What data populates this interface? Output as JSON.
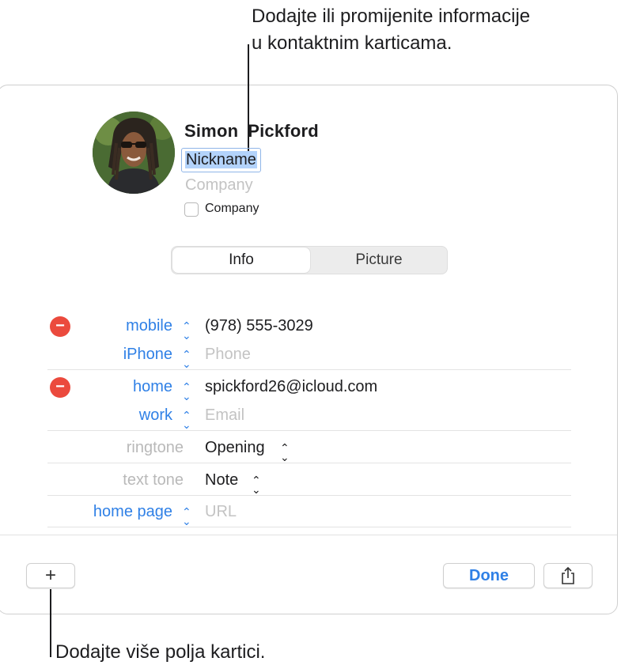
{
  "callouts": {
    "top_line1": "Dodajte ili promijenite informacije",
    "top_line2": "u kontaktnim karticama.",
    "bottom": "Dodajte više polja kartici."
  },
  "contact": {
    "first_name": "Simon",
    "last_name": "Pickford",
    "nickname": "Nickname",
    "company_placeholder": "Company",
    "company_checkbox_label": "Company",
    "company_checkbox_checked": false
  },
  "tabs": [
    {
      "label": "Info",
      "selected": true
    },
    {
      "label": "Picture",
      "selected": false
    }
  ],
  "fields": {
    "phone1": {
      "label": "mobile",
      "value": "(978) 555-3029"
    },
    "phone2": {
      "label": "iPhone",
      "placeholder": "Phone"
    },
    "email1": {
      "label": "home",
      "value": "spickford26@icloud.com"
    },
    "email2": {
      "label": "work",
      "placeholder": "Email"
    },
    "ringtone": {
      "label": "ringtone",
      "value": "Opening"
    },
    "texttone": {
      "label": "text tone",
      "value": "Note"
    },
    "homepage": {
      "label": "home page",
      "placeholder": "URL"
    }
  },
  "footer": {
    "add_label": "+",
    "done_label": "Done"
  },
  "icons": {
    "remove": "minus-circle-icon",
    "stepper": "up-down-chevron-icon",
    "share": "share-icon"
  },
  "colors": {
    "accent": "#2f80e6",
    "remove_red": "#eb4a3d",
    "selection": "#b3d3fb",
    "placeholder": "#c3c3c3"
  }
}
